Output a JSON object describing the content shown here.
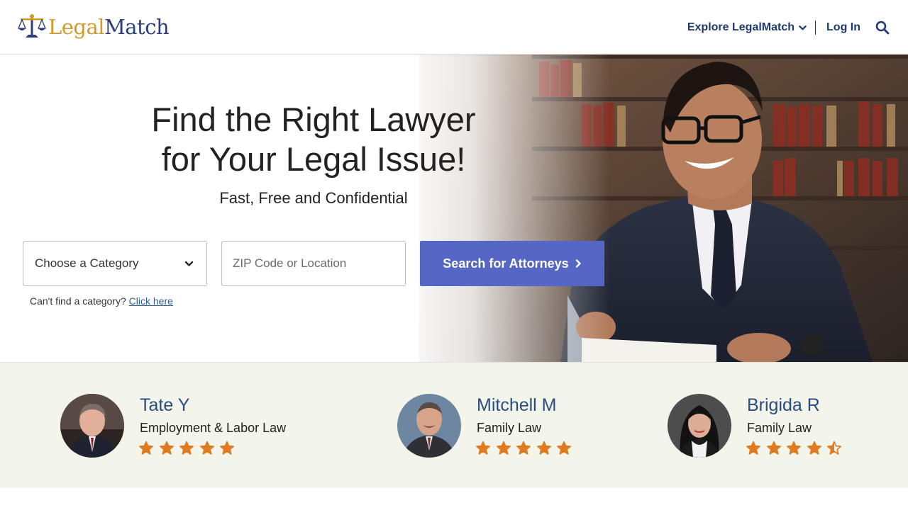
{
  "brand": {
    "legal": "Legal",
    "match": "Match",
    "accent": "#d39a2c",
    "primary": "#2b3d7a"
  },
  "nav": {
    "explore_label": "Explore LegalMatch",
    "login_label": "Log In",
    "search_icon": "search-icon"
  },
  "hero": {
    "title_line1": "Find the Right Lawyer",
    "title_line2": "for Your Legal Issue!",
    "subtitle": "Fast, Free and Confidential",
    "category_select": {
      "selected": "Choose a Category"
    },
    "location_input": {
      "placeholder": "ZIP Code or Location",
      "value": ""
    },
    "search_button": "Search for Attorneys",
    "cant_find_text": "Can't find a category?",
    "cant_find_link": "Click here",
    "button_color": "#5566c4"
  },
  "reviews": [
    {
      "name": "Tate Y",
      "practice": "Employment & Labor Law",
      "rating": 5
    },
    {
      "name": "Mitchell M",
      "practice": "Family Law",
      "rating": 5
    },
    {
      "name": "Brigida R",
      "practice": "Family Law",
      "rating": 4.5
    }
  ],
  "colors": {
    "star": "#e07b1f",
    "review_name": "#2a4d7f",
    "review_band": "#f3f5ea"
  }
}
